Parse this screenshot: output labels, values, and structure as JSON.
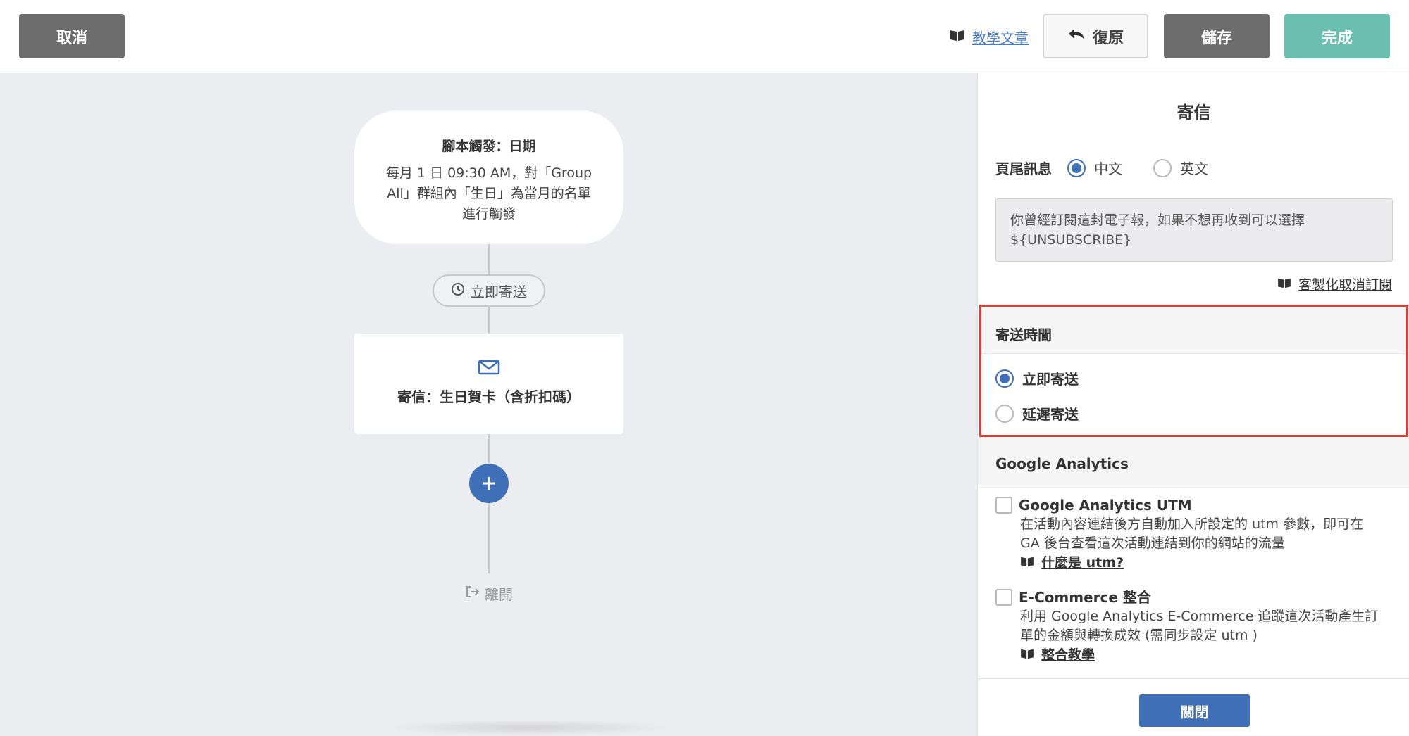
{
  "toolbar": {
    "cancel_label": "取消",
    "tutorial_label": "教學文章",
    "undo_label": "復原",
    "save_label": "儲存",
    "done_label": "完成"
  },
  "flow": {
    "trigger": {
      "title": "腳本觸發：日期",
      "desc_line1": "每月 1 日 09:30 AM，對「Group",
      "desc_line2": "All」群組內「生日」為當月的名單",
      "desc_line3": "進行觸發"
    },
    "timing_pill": "立即寄送",
    "email_node": {
      "label": "寄信：生日賀卡（含折扣碼）"
    },
    "exit_label": "離開"
  },
  "panel": {
    "title": "寄信",
    "footer_info": {
      "label": "頁尾訊息",
      "options": [
        "中文",
        "英文"
      ],
      "selected": "中文"
    },
    "unsubscribe_text_line1": "你曾經訂閱這封電子報，如果不想再收到可以選擇",
    "unsubscribe_text_line2": "${UNSUBSCRIBE}",
    "custom_unsub_link": "客製化取消訂閱",
    "send_time": {
      "label": "寄送時間",
      "options": [
        "立即寄送",
        "延遲寄送"
      ],
      "selected": "立即寄送"
    },
    "ga": {
      "label": "Google Analytics",
      "utm": {
        "title": "Google Analytics UTM",
        "desc_line1": "在活動內容連結後方自動加入所設定的 utm 參數，即可在",
        "desc_line2": "GA 後台查看這次活動連結到你的網站的流量",
        "link": "什麼是 utm?"
      },
      "ecommerce": {
        "title": "E-Commerce 整合",
        "desc_line1": "利用 Google Analytics E-Commerce 追蹤這次活動產生訂",
        "desc_line2": "單的金額與轉換成效 (需同步設定 utm )",
        "link": "整合教學"
      }
    },
    "close_label": "關閉"
  },
  "colors": {
    "primary": "#3f6fb6",
    "done": "#6bbfb0",
    "dark_button": "#6d6d6d",
    "highlight": "#dd3e31",
    "canvas_bg": "#ecedf0"
  }
}
